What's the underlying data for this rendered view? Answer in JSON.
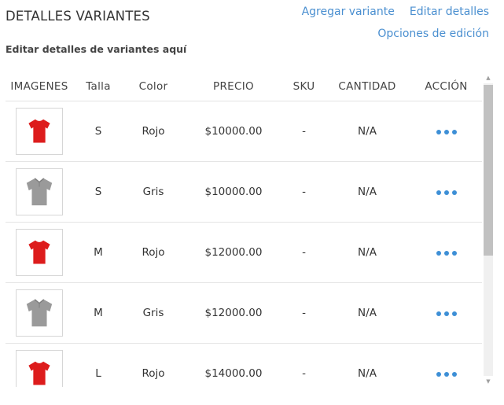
{
  "header": {
    "title": "DETALLES VARIANTES",
    "subtitle": "Editar detalles de variantes aquí",
    "links": {
      "add_variant": "Agregar variante",
      "edit_details": "Editar detalles",
      "edit_options": "Opciones de edición"
    }
  },
  "table": {
    "columns": [
      "IMAGENES",
      "Talla",
      "Color",
      "PRECIO",
      "SKU",
      "CANTIDAD",
      "ACCIÓN"
    ],
    "rows": [
      {
        "image_icon": "red-tshirt-icon",
        "size": "S",
        "color": "Rojo",
        "price": "$10000.00",
        "sku": "-",
        "quantity": "N/A"
      },
      {
        "image_icon": "gray-polo-icon",
        "size": "S",
        "color": "Gris",
        "price": "$10000.00",
        "sku": "-",
        "quantity": "N/A"
      },
      {
        "image_icon": "red-tshirt-icon",
        "size": "M",
        "color": "Rojo",
        "price": "$12000.00",
        "sku": "-",
        "quantity": "N/A"
      },
      {
        "image_icon": "gray-polo-icon",
        "size": "M",
        "color": "Gris",
        "price": "$12000.00",
        "sku": "-",
        "quantity": "N/A"
      },
      {
        "image_icon": "red-tshirt-icon",
        "size": "L",
        "color": "Rojo",
        "price": "$14000.00",
        "sku": "-",
        "quantity": "N/A"
      }
    ]
  },
  "colors": {
    "link": "#4a8fd0",
    "action_dots": "#3d8fd6",
    "shirt_red": "#dd1c1c",
    "shirt_gray": "#9a9a9a"
  }
}
